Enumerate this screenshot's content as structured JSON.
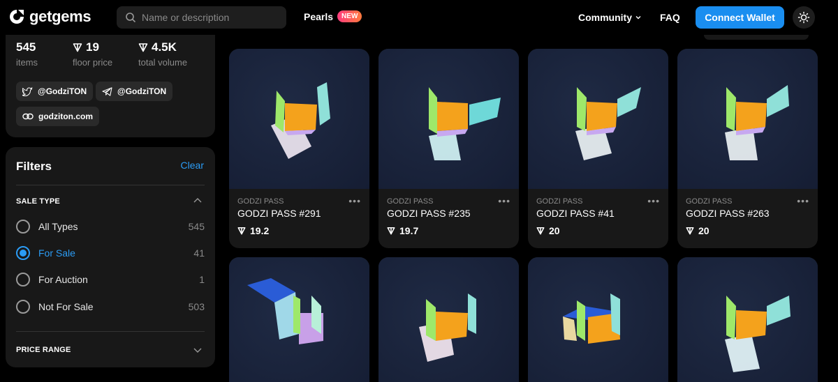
{
  "header": {
    "logo_text": "getgems",
    "search_placeholder": "Name or description",
    "pearls_label": "Pearls",
    "pearls_badge": "NEW",
    "community_label": "Community",
    "faq_label": "FAQ",
    "connect_label": "Connect Wallet"
  },
  "stats": {
    "items_value": "545",
    "items_label": "items",
    "floor_value": "19",
    "floor_label": "floor price",
    "volume_value": "4.5K",
    "volume_label": "total volume"
  },
  "socials": {
    "twitter": "@GodziTON",
    "telegram": "@GodziTON",
    "website": "godziton.com"
  },
  "filters": {
    "title": "Filters",
    "clear_label": "Clear",
    "sale_type_title": "SALE TYPE",
    "options": [
      {
        "label": "All Types",
        "count": "545",
        "selected": false
      },
      {
        "label": "For Sale",
        "count": "41",
        "selected": true
      },
      {
        "label": "For Auction",
        "count": "1",
        "selected": false
      },
      {
        "label": "Not For Sale",
        "count": "503",
        "selected": false
      }
    ],
    "price_range_title": "PRICE RANGE"
  },
  "cards": [
    {
      "collection": "GODZI PASS",
      "name": "GODZI PASS #291",
      "price": "19.2"
    },
    {
      "collection": "GODZI PASS",
      "name": "GODZI PASS #235",
      "price": "19.7"
    },
    {
      "collection": "GODZI PASS",
      "name": "GODZI PASS #41",
      "price": "20"
    },
    {
      "collection": "GODZI PASS",
      "name": "GODZI PASS #263",
      "price": "20"
    },
    {
      "collection": "",
      "name": "",
      "price": ""
    },
    {
      "collection": "",
      "name": "",
      "price": ""
    },
    {
      "collection": "",
      "name": "",
      "price": ""
    },
    {
      "collection": "",
      "name": "",
      "price": ""
    }
  ],
  "colors": {
    "accent": "#1a8ef0",
    "link": "#2b9cf5",
    "panel": "#181818",
    "background": "#000000"
  }
}
